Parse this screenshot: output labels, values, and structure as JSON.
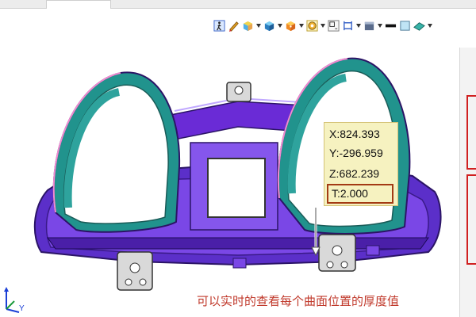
{
  "toolbar": {
    "icons": [
      "walk-icon",
      "pen-icon",
      "box-icon",
      "solid-icon",
      "view-cube-icon",
      "sphere-icon",
      "zoom-icon",
      "grid-icon",
      "box-frame-icon",
      "layer-icon",
      "line-style-icon",
      "surface-icon"
    ]
  },
  "readout": {
    "x": "X:824.393",
    "y": "Y:-296.959",
    "z": "Z:682.239",
    "t": "T:2.000"
  },
  "caption": "可以实时的查看每个曲面位置的厚度值",
  "axes": {
    "y_label": "Y"
  },
  "colors": {
    "surface_teal": "#1f8f8a",
    "frame_purple": "#6a2bd6",
    "readout_bg": "#f6f2c0",
    "t_border": "#a33a14",
    "caption": "#c0392b"
  }
}
